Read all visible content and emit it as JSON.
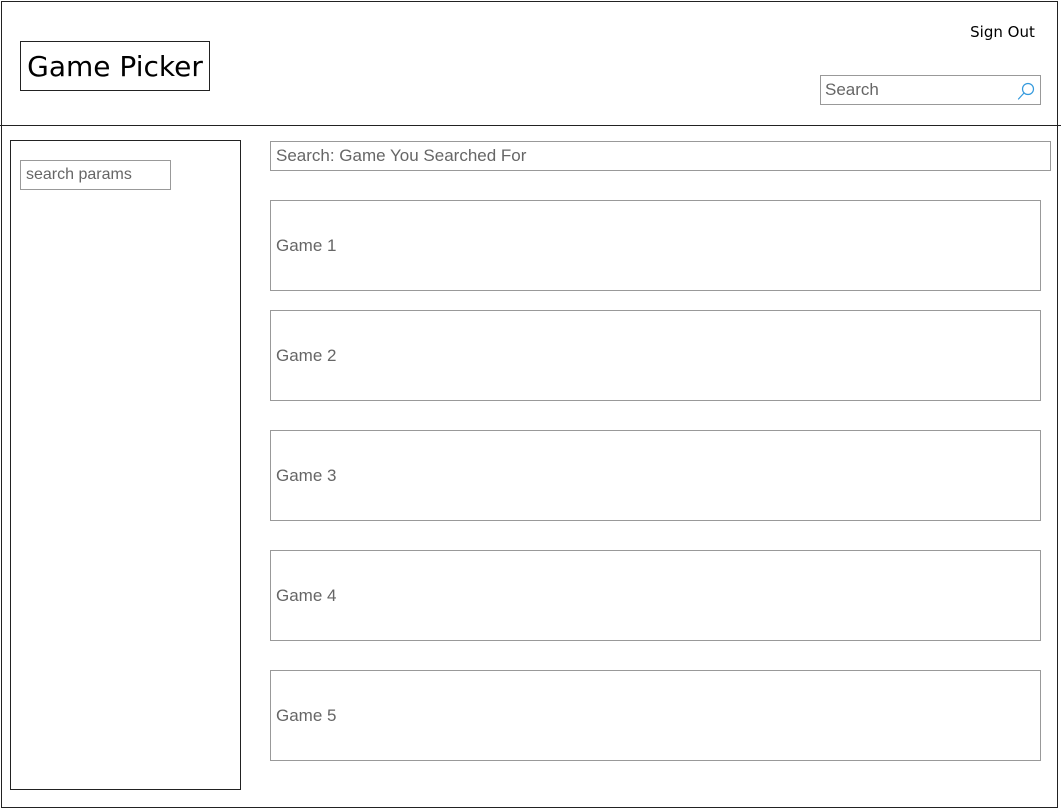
{
  "header": {
    "logo_text": "Game Picker",
    "sign_out_label": "Sign Out",
    "search": {
      "placeholder": "Search",
      "icon": "search-icon",
      "icon_color": "#3399dd"
    }
  },
  "sidebar": {
    "search_params_placeholder": "search params"
  },
  "results": {
    "query_label": "Search: Game You Searched For",
    "games": [
      {
        "label": "Game 1"
      },
      {
        "label": "Game 2"
      },
      {
        "label": "Game 3"
      },
      {
        "label": "Game 4"
      },
      {
        "label": "Game 5"
      }
    ]
  }
}
